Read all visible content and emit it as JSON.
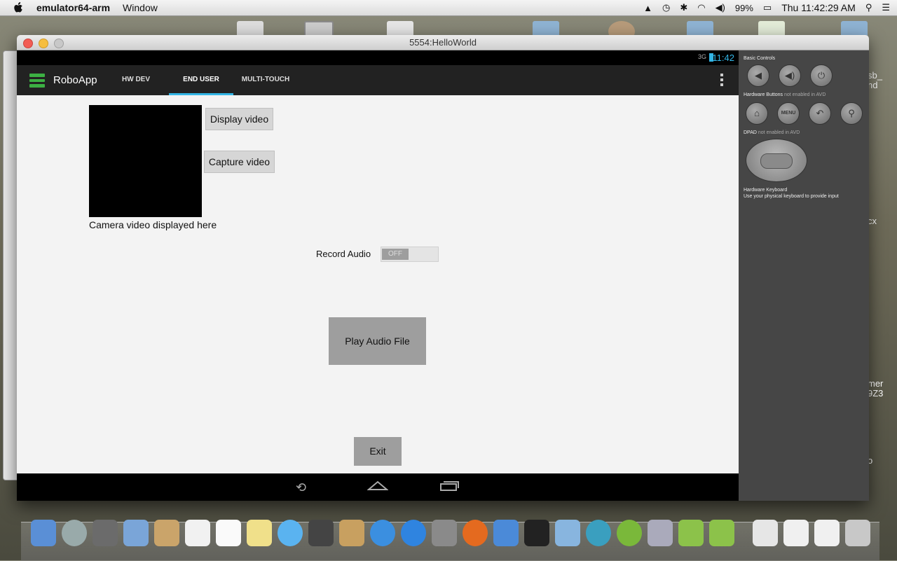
{
  "menubar": {
    "app_name": "emulator64-arm",
    "menu_window": "Window",
    "battery": "99%",
    "clock": "Thu 11:42:29 AM"
  },
  "window": {
    "title": "5554:HelloWorld"
  },
  "statusbar": {
    "signal": "3G",
    "time": "11:42"
  },
  "actionbar": {
    "app_title": "RoboApp",
    "tabs": [
      {
        "label": "HW DEV",
        "active": false
      },
      {
        "label": "END USER",
        "active": true
      },
      {
        "label": "MULTI-TOUCH",
        "active": false
      }
    ]
  },
  "content": {
    "display_video": "Display video",
    "capture_video": "Capture video",
    "camera_caption": "Camera video displayed here",
    "record_audio_label": "Record Audio",
    "record_toggle": "OFF",
    "play_audio": "Play Audio File",
    "exit": "Exit"
  },
  "panel": {
    "basic_controls": "Basic Controls",
    "hw_buttons": "Hardware Buttons",
    "hw_buttons_note": "not enabled in AVD",
    "dpad": "DPAD",
    "dpad_note": "not enabled in AVD",
    "keyboard": "Hardware Keyboard",
    "keyboard_note": "Use your physical keyboard to provide input",
    "menu_label": "MENU"
  },
  "desktop_labels": {
    "a": "sb_",
    "b": "nd",
    "c": "cx",
    "d": "mer",
    "e": "9Z3",
    "f": "o"
  },
  "colors": {
    "accent": "#33b5e5",
    "logo_green": "#3cb043"
  }
}
